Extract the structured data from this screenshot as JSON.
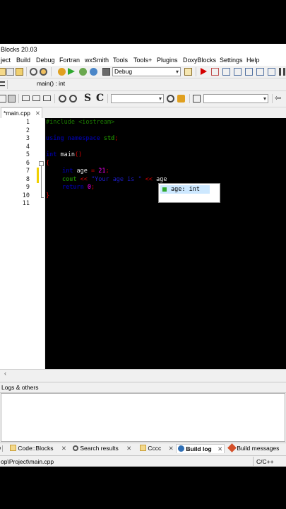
{
  "window": {
    "title": "Blocks 20.03"
  },
  "menu": [
    "ject",
    "Build",
    "Debug",
    "Fortran",
    "wxSmith",
    "Tools",
    "Tools+",
    "Plugins",
    "DoxyBlocks",
    "Settings",
    "Help"
  ],
  "toolbar": {
    "build_target": "Debug",
    "scope": "main() : int",
    "search_combo": "",
    "search_combo2": ""
  },
  "editor": {
    "file_tab": "*main.cpp",
    "line_numbers": [
      "1",
      "2",
      "3",
      "4",
      "5",
      "6",
      "7",
      "8",
      "9",
      "10",
      "11"
    ],
    "code": {
      "l1_include": "#include",
      "l1_header": "<iostream>",
      "l3_using": "using",
      "l3_namespace": "namespace",
      "l3_std": "std",
      "l3_semi": ";",
      "l5_int": "int",
      "l5_main": "main",
      "l5_parens": "()",
      "l6_brace": "{",
      "l7_int": "int",
      "l7_age": "age",
      "l7_eq": "=",
      "l7_val": "21",
      "l7_semi": ";",
      "l8_cout": "cout",
      "l8_op1": "<<",
      "l8_str": "\"Your age is \"",
      "l8_op2": "<<",
      "l8_age": "age",
      "l9_return": "return",
      "l9_zero": "0",
      "l9_semi": ";",
      "l10_brace": "}"
    },
    "autocomplete": {
      "item": "age: int"
    }
  },
  "logs": {
    "title": "Logs & others",
    "tabs": [
      "Code::Blocks",
      "Search results",
      "Cccc",
      "Build log",
      "Build messages"
    ],
    "active_tab": "Build log"
  },
  "status": {
    "path": "op\\Project\\main.cpp",
    "language": "C/C++"
  },
  "colors": {
    "accent_run": "#2fa82f",
    "stop": "#d40000",
    "editor_bg": "#000000"
  }
}
